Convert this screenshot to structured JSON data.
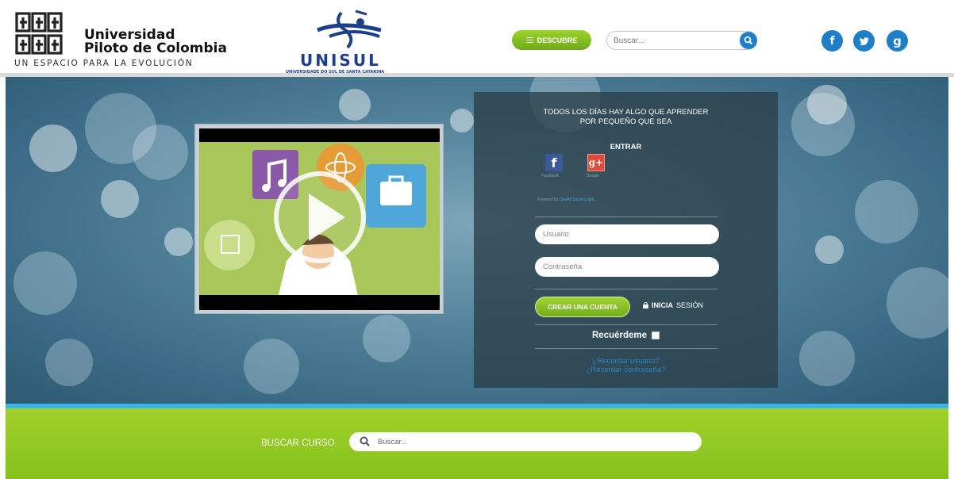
{
  "header": {
    "upc": {
      "name": "Universidad\nPiloto de Colombia",
      "tagline": "UN ESPACIO PARA LA EVOLUCIÓN"
    },
    "unisul": {
      "name": "UNISUL",
      "subtitle": "UNIVERSIDADE DO SUL DE SANTA CATARINA"
    },
    "menu_label": "DESCUBRE",
    "search_placeholder": "Buscar...",
    "social": [
      "f",
      "t",
      "g"
    ]
  },
  "login": {
    "slogan_line1": "TODOS LOS DÍAS HAY ALGO QUE APRENDER",
    "slogan_line2": "POR PEQUEÑO QUE SEA",
    "entrar": "ENTRAR",
    "facebook_caption": "Facebook",
    "google_caption": "Google",
    "powered_prefix": "Powered by",
    "powered_link": "OneAll Social Login",
    "usuario_placeholder": "Usuario",
    "password_placeholder": "Contraseña",
    "crear_label": "CREAR UNA CUENTA",
    "inicia_bold": "INICIA",
    "inicia_rest": "SESIÓN",
    "remember_label": "Recuérdeme",
    "forgot_user": "¿Recordar usuario?",
    "forgot_password": "¿Recordar contraseña?"
  },
  "footer": {
    "buscar_label": "BUSCAR CURSO",
    "search_placeholder": "Buscar..."
  },
  "colors": {
    "accent_green": "#8cc420",
    "brand_blue": "#1e7ec8",
    "link_blue": "#2b84c5"
  }
}
